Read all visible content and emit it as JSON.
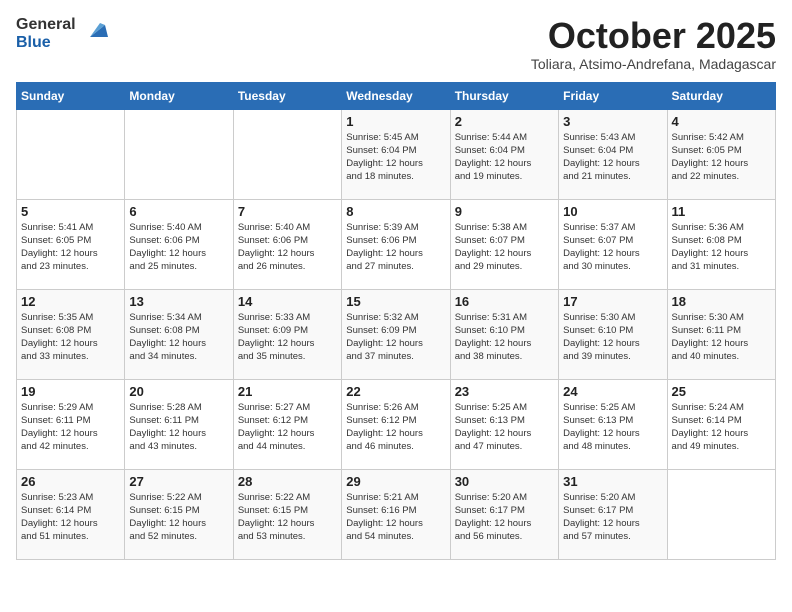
{
  "header": {
    "logo_line1": "General",
    "logo_line2": "Blue",
    "month": "October 2025",
    "location": "Toliara, Atsimo-Andrefana, Madagascar"
  },
  "weekdays": [
    "Sunday",
    "Monday",
    "Tuesday",
    "Wednesday",
    "Thursday",
    "Friday",
    "Saturday"
  ],
  "weeks": [
    [
      {
        "day": "",
        "info": ""
      },
      {
        "day": "",
        "info": ""
      },
      {
        "day": "",
        "info": ""
      },
      {
        "day": "1",
        "info": "Sunrise: 5:45 AM\nSunset: 6:04 PM\nDaylight: 12 hours\nand 18 minutes."
      },
      {
        "day": "2",
        "info": "Sunrise: 5:44 AM\nSunset: 6:04 PM\nDaylight: 12 hours\nand 19 minutes."
      },
      {
        "day": "3",
        "info": "Sunrise: 5:43 AM\nSunset: 6:04 PM\nDaylight: 12 hours\nand 21 minutes."
      },
      {
        "day": "4",
        "info": "Sunrise: 5:42 AM\nSunset: 6:05 PM\nDaylight: 12 hours\nand 22 minutes."
      }
    ],
    [
      {
        "day": "5",
        "info": "Sunrise: 5:41 AM\nSunset: 6:05 PM\nDaylight: 12 hours\nand 23 minutes."
      },
      {
        "day": "6",
        "info": "Sunrise: 5:40 AM\nSunset: 6:06 PM\nDaylight: 12 hours\nand 25 minutes."
      },
      {
        "day": "7",
        "info": "Sunrise: 5:40 AM\nSunset: 6:06 PM\nDaylight: 12 hours\nand 26 minutes."
      },
      {
        "day": "8",
        "info": "Sunrise: 5:39 AM\nSunset: 6:06 PM\nDaylight: 12 hours\nand 27 minutes."
      },
      {
        "day": "9",
        "info": "Sunrise: 5:38 AM\nSunset: 6:07 PM\nDaylight: 12 hours\nand 29 minutes."
      },
      {
        "day": "10",
        "info": "Sunrise: 5:37 AM\nSunset: 6:07 PM\nDaylight: 12 hours\nand 30 minutes."
      },
      {
        "day": "11",
        "info": "Sunrise: 5:36 AM\nSunset: 6:08 PM\nDaylight: 12 hours\nand 31 minutes."
      }
    ],
    [
      {
        "day": "12",
        "info": "Sunrise: 5:35 AM\nSunset: 6:08 PM\nDaylight: 12 hours\nand 33 minutes."
      },
      {
        "day": "13",
        "info": "Sunrise: 5:34 AM\nSunset: 6:08 PM\nDaylight: 12 hours\nand 34 minutes."
      },
      {
        "day": "14",
        "info": "Sunrise: 5:33 AM\nSunset: 6:09 PM\nDaylight: 12 hours\nand 35 minutes."
      },
      {
        "day": "15",
        "info": "Sunrise: 5:32 AM\nSunset: 6:09 PM\nDaylight: 12 hours\nand 37 minutes."
      },
      {
        "day": "16",
        "info": "Sunrise: 5:31 AM\nSunset: 6:10 PM\nDaylight: 12 hours\nand 38 minutes."
      },
      {
        "day": "17",
        "info": "Sunrise: 5:30 AM\nSunset: 6:10 PM\nDaylight: 12 hours\nand 39 minutes."
      },
      {
        "day": "18",
        "info": "Sunrise: 5:30 AM\nSunset: 6:11 PM\nDaylight: 12 hours\nand 40 minutes."
      }
    ],
    [
      {
        "day": "19",
        "info": "Sunrise: 5:29 AM\nSunset: 6:11 PM\nDaylight: 12 hours\nand 42 minutes."
      },
      {
        "day": "20",
        "info": "Sunrise: 5:28 AM\nSunset: 6:11 PM\nDaylight: 12 hours\nand 43 minutes."
      },
      {
        "day": "21",
        "info": "Sunrise: 5:27 AM\nSunset: 6:12 PM\nDaylight: 12 hours\nand 44 minutes."
      },
      {
        "day": "22",
        "info": "Sunrise: 5:26 AM\nSunset: 6:12 PM\nDaylight: 12 hours\nand 46 minutes."
      },
      {
        "day": "23",
        "info": "Sunrise: 5:25 AM\nSunset: 6:13 PM\nDaylight: 12 hours\nand 47 minutes."
      },
      {
        "day": "24",
        "info": "Sunrise: 5:25 AM\nSunset: 6:13 PM\nDaylight: 12 hours\nand 48 minutes."
      },
      {
        "day": "25",
        "info": "Sunrise: 5:24 AM\nSunset: 6:14 PM\nDaylight: 12 hours\nand 49 minutes."
      }
    ],
    [
      {
        "day": "26",
        "info": "Sunrise: 5:23 AM\nSunset: 6:14 PM\nDaylight: 12 hours\nand 51 minutes."
      },
      {
        "day": "27",
        "info": "Sunrise: 5:22 AM\nSunset: 6:15 PM\nDaylight: 12 hours\nand 52 minutes."
      },
      {
        "day": "28",
        "info": "Sunrise: 5:22 AM\nSunset: 6:15 PM\nDaylight: 12 hours\nand 53 minutes."
      },
      {
        "day": "29",
        "info": "Sunrise: 5:21 AM\nSunset: 6:16 PM\nDaylight: 12 hours\nand 54 minutes."
      },
      {
        "day": "30",
        "info": "Sunrise: 5:20 AM\nSunset: 6:17 PM\nDaylight: 12 hours\nand 56 minutes."
      },
      {
        "day": "31",
        "info": "Sunrise: 5:20 AM\nSunset: 6:17 PM\nDaylight: 12 hours\nand 57 minutes."
      },
      {
        "day": "",
        "info": ""
      }
    ]
  ]
}
